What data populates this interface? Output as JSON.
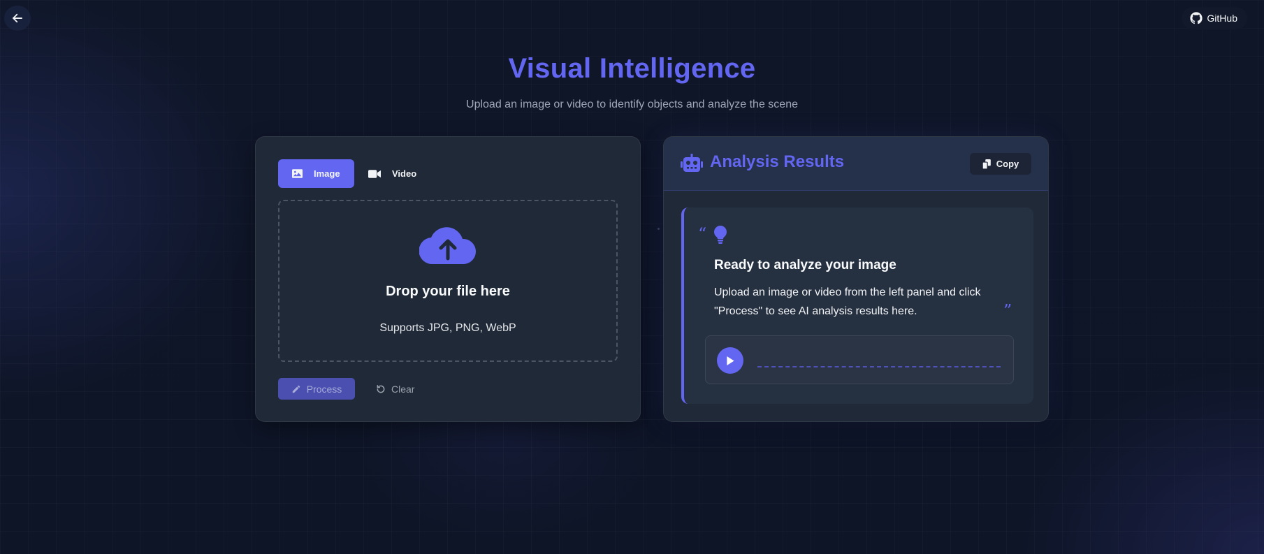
{
  "nav": {
    "back_icon": "arrow-left-icon",
    "github_label": "GitHub",
    "github_icon": "github-icon"
  },
  "header": {
    "title": "Visual Intelligence",
    "subtitle": "Upload an image or video to identify objects and analyze the scene"
  },
  "upload_panel": {
    "tabs": [
      {
        "label": "Image",
        "icon": "image-icon",
        "active": true
      },
      {
        "label": "Video",
        "icon": "video-icon",
        "active": false
      }
    ],
    "dropzone": {
      "icon": "cloud-upload-icon",
      "title": "Drop your file here",
      "subtitle": "Supports JPG, PNG, WebP"
    },
    "process_label": "Process",
    "clear_label": "Clear"
  },
  "results_panel": {
    "title": "Analysis Results",
    "icon": "robot-icon",
    "copy_label": "Copy",
    "card": {
      "open_quote": "“",
      "close_quote": "”",
      "icon": "lightbulb-icon",
      "title": "Ready to analyze your image",
      "text": "Upload an image or video from the left panel and click \"Process\" to see AI analysis results here."
    },
    "player": {
      "play_icon": "play-icon"
    }
  },
  "colors": {
    "accent": "#6366f1",
    "background": "#0f1627",
    "panel": "#1f2937"
  }
}
